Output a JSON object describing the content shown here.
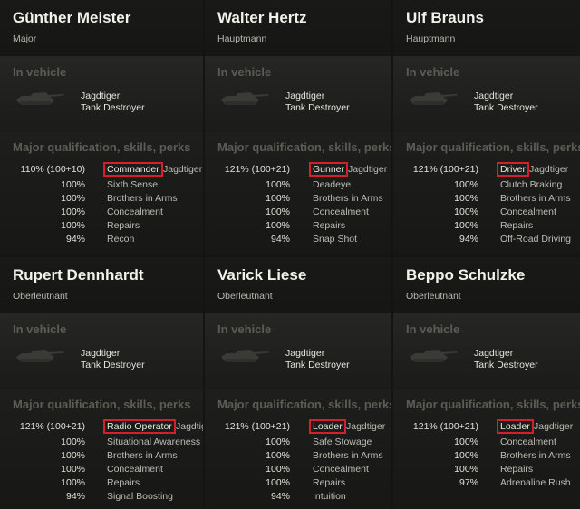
{
  "labels": {
    "in_vehicle": "In vehicle",
    "qualification": "Major qualification, skills, perks"
  },
  "crew": [
    {
      "name": "Günther Meister",
      "rank": "Major",
      "tank": "Jagdtiger",
      "tank_class": "Tank Destroyer",
      "primary": {
        "pct": "110% (100+10)",
        "role": "Commander",
        "tank": "Jagdtiger"
      },
      "skills": [
        {
          "pct": "100%",
          "name": "Sixth Sense"
        },
        {
          "pct": "100%",
          "name": "Brothers in Arms"
        },
        {
          "pct": "100%",
          "name": "Concealment"
        },
        {
          "pct": "100%",
          "name": "Repairs"
        },
        {
          "pct": "94%",
          "name": "Recon"
        }
      ]
    },
    {
      "name": "Walter Hertz",
      "rank": "Hauptmann",
      "tank": "Jagdtiger",
      "tank_class": "Tank Destroyer",
      "primary": {
        "pct": "121% (100+21)",
        "role": "Gunner",
        "tank": "Jagdtiger"
      },
      "skills": [
        {
          "pct": "100%",
          "name": "Deadeye"
        },
        {
          "pct": "100%",
          "name": "Brothers in Arms"
        },
        {
          "pct": "100%",
          "name": "Concealment"
        },
        {
          "pct": "100%",
          "name": "Repairs"
        },
        {
          "pct": "94%",
          "name": "Snap Shot"
        }
      ]
    },
    {
      "name": "Ulf Brauns",
      "rank": "Hauptmann",
      "tank": "Jagdtiger",
      "tank_class": "Tank Destroyer",
      "primary": {
        "pct": "121% (100+21)",
        "role": "Driver",
        "tank": "Jagdtiger"
      },
      "skills": [
        {
          "pct": "100%",
          "name": "Clutch Braking"
        },
        {
          "pct": "100%",
          "name": "Brothers in Arms"
        },
        {
          "pct": "100%",
          "name": "Concealment"
        },
        {
          "pct": "100%",
          "name": "Repairs"
        },
        {
          "pct": "94%",
          "name": "Off-Road Driving"
        }
      ]
    },
    {
      "name": "Rupert Dennhardt",
      "rank": "Oberleutnant",
      "tank": "Jagdtiger",
      "tank_class": "Tank Destroyer",
      "primary": {
        "pct": "121% (100+21)",
        "role": "Radio Operator",
        "tank": "Jagdtiger"
      },
      "skills": [
        {
          "pct": "100%",
          "name": "Situational Awareness"
        },
        {
          "pct": "100%",
          "name": "Brothers in Arms"
        },
        {
          "pct": "100%",
          "name": "Concealment"
        },
        {
          "pct": "100%",
          "name": "Repairs"
        },
        {
          "pct": "94%",
          "name": "Signal Boosting"
        }
      ]
    },
    {
      "name": "Varick Liese",
      "rank": "Oberleutnant",
      "tank": "Jagdtiger",
      "tank_class": "Tank Destroyer",
      "primary": {
        "pct": "121% (100+21)",
        "role": "Loader",
        "tank": "Jagdtiger"
      },
      "skills": [
        {
          "pct": "100%",
          "name": "Safe Stowage"
        },
        {
          "pct": "100%",
          "name": "Brothers in Arms"
        },
        {
          "pct": "100%",
          "name": "Concealment"
        },
        {
          "pct": "100%",
          "name": "Repairs"
        },
        {
          "pct": "94%",
          "name": "Intuition"
        }
      ]
    },
    {
      "name": "Beppo Schulzke",
      "rank": "Oberleutnant",
      "tank": "Jagdtiger",
      "tank_class": "Tank Destroyer",
      "primary": {
        "pct": "121% (100+21)",
        "role": "Loader",
        "tank": "Jagdtiger"
      },
      "skills": [
        {
          "pct": "100%",
          "name": "Concealment"
        },
        {
          "pct": "100%",
          "name": "Brothers in Arms"
        },
        {
          "pct": "100%",
          "name": "Repairs"
        },
        {
          "pct": "97%",
          "name": "Adrenaline Rush"
        }
      ]
    }
  ]
}
